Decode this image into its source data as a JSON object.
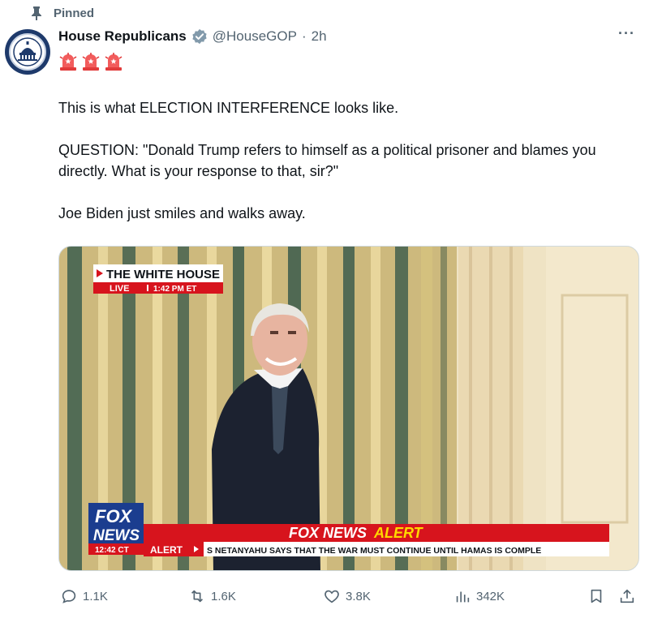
{
  "pinned": {
    "label": "Pinned"
  },
  "author": {
    "name": "House Republicans",
    "handle": "@HouseGOP",
    "separator": "·",
    "time": "2h",
    "verified": true
  },
  "emoji": [
    "police-light",
    "police-light",
    "police-light"
  ],
  "tweet": {
    "line1": "This is what ELECTION INTERFERENCE looks like.",
    "line2": "QUESTION: \"Donald Trump refers to himself as a political prisoner and blames you directly. What is your response to that, sir?\"",
    "line3": "Joe Biden just smiles and walks away."
  },
  "media": {
    "location_banner": "THE WHITE HOUSE",
    "live_label": "LIVE",
    "live_time": "1:42 PM ET",
    "network_top": "FOX",
    "network_bottom": "NEWS",
    "network_time": "12:42 CT",
    "alert_title_a": "FOX NEWS",
    "alert_title_b": "ALERT",
    "alert_tag": "ALERT",
    "ticker": "S NETANYAHU SAYS THAT THE WAR MUST CONTINUE UNTIL HAMAS IS COMPLE"
  },
  "actions": {
    "replies": "1.1K",
    "reposts": "1.6K",
    "likes": "3.8K",
    "views": "342K"
  },
  "colors": {
    "text": "#0f1419",
    "muted": "#536471",
    "verified": "#829aab",
    "fox_red": "#d7141d",
    "alert_yellow": "#ffd800"
  }
}
